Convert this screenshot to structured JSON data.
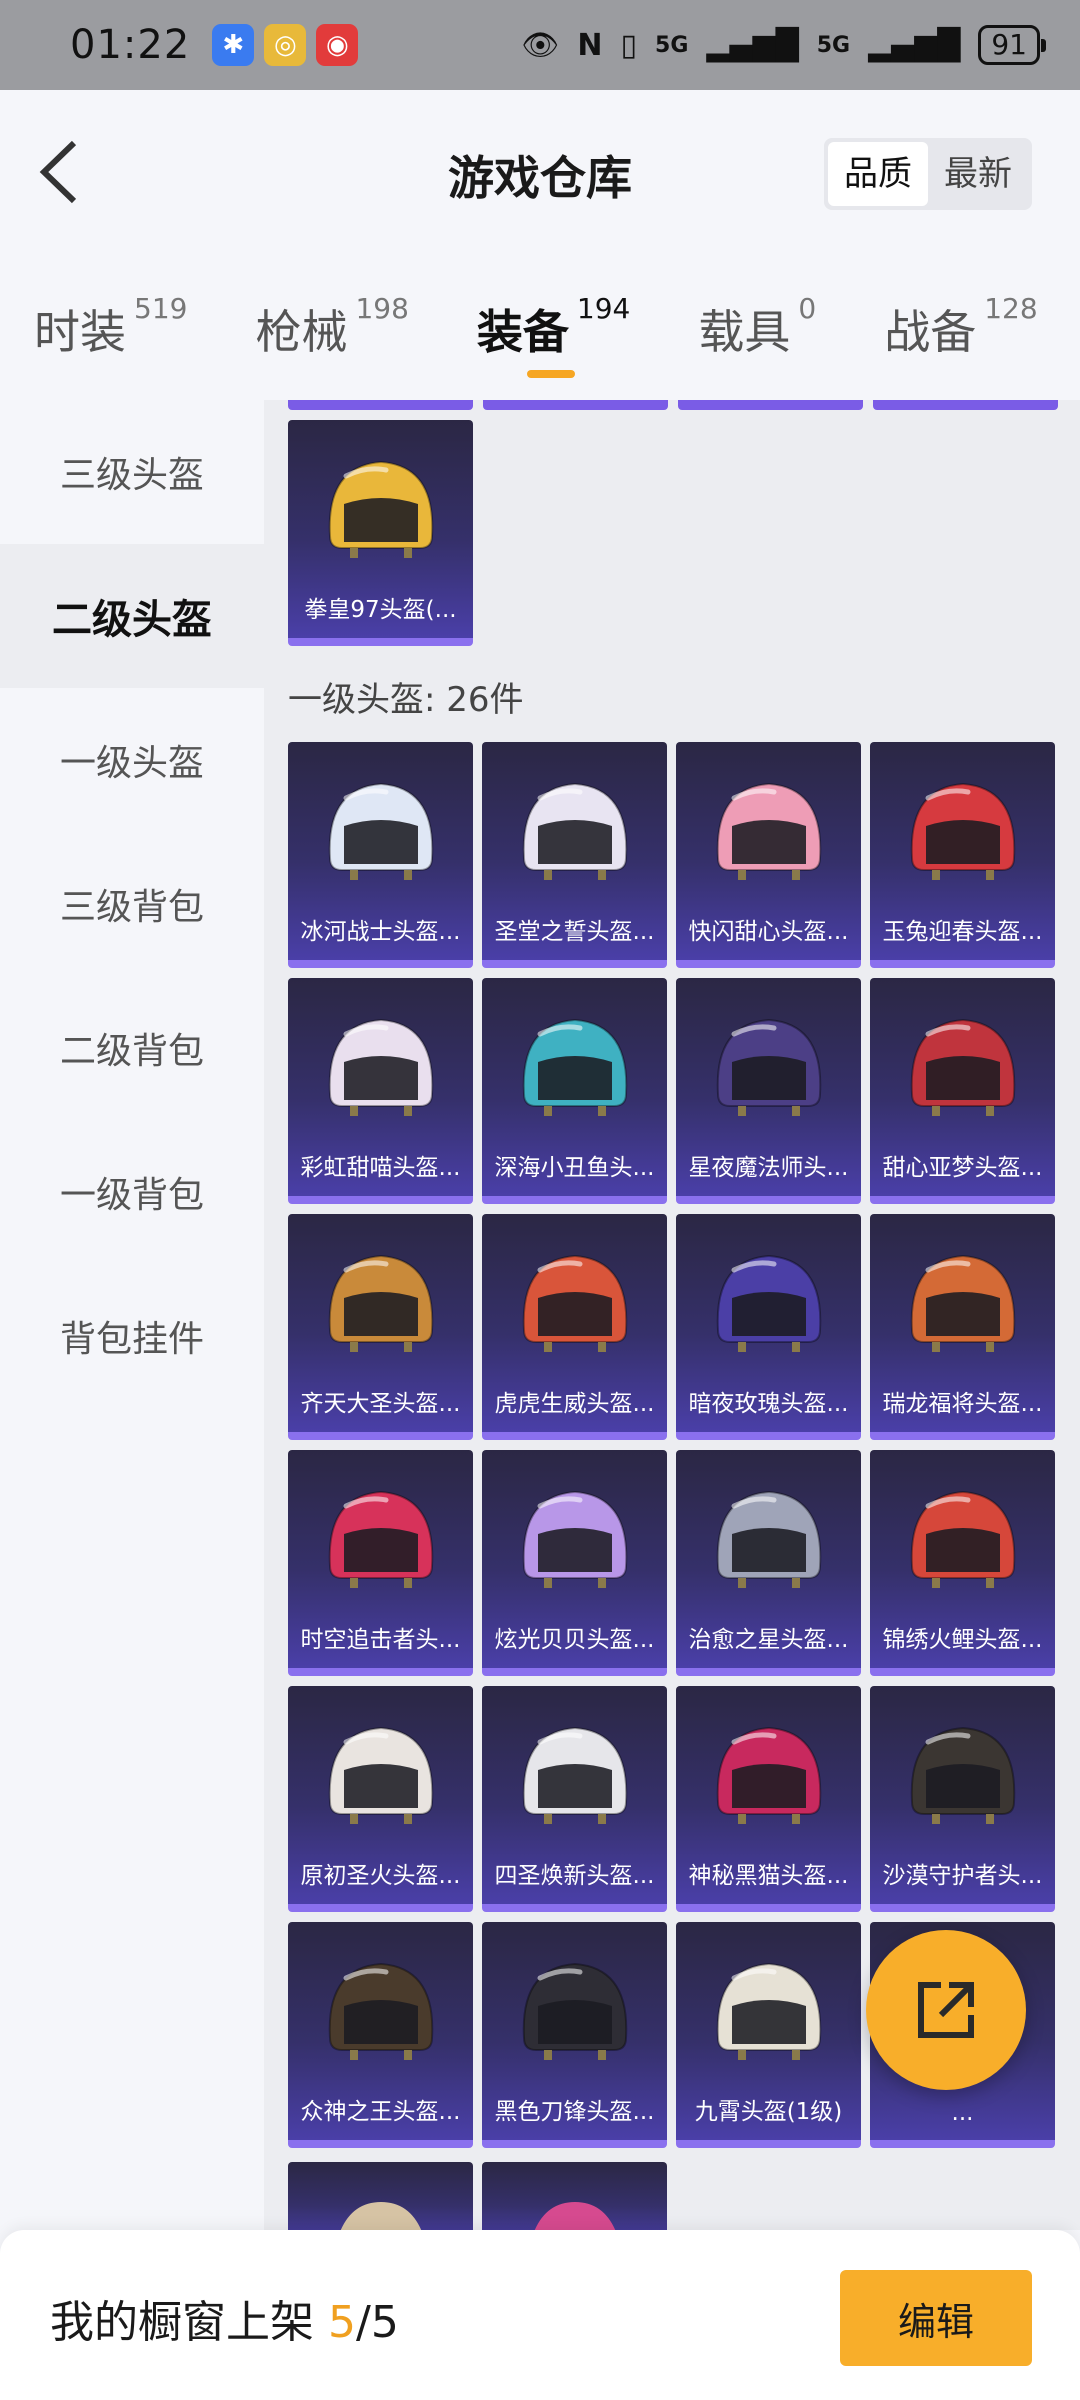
{
  "status_bar": {
    "time": "01:22",
    "network_1": "5G",
    "network_2": "5G",
    "battery": "91"
  },
  "header": {
    "title": "游戏仓库",
    "sort_quality": "品质",
    "sort_newest": "最新"
  },
  "category_tabs": [
    {
      "label": "时装",
      "count": "519"
    },
    {
      "label": "枪械",
      "count": "198"
    },
    {
      "label": "装备",
      "count": "194"
    },
    {
      "label": "载具",
      "count": "0"
    },
    {
      "label": "战备",
      "count": "128"
    }
  ],
  "sidebar": [
    {
      "label": "三级头盔"
    },
    {
      "label": "二级头盔"
    },
    {
      "label": "一级头盔"
    },
    {
      "label": "三级背包"
    },
    {
      "label": "二级背包"
    },
    {
      "label": "一级背包"
    },
    {
      "label": "背包挂件"
    }
  ],
  "level2_items": [
    {
      "name": "拳皇97头盔(...",
      "color": "#e9b73a"
    }
  ],
  "section_level1": "一级头盔: 26件",
  "level1_items": [
    {
      "name": "冰河战士头盔...",
      "color": "#dfe7f5"
    },
    {
      "name": "圣堂之誓头盔...",
      "color": "#e8e4f2"
    },
    {
      "name": "快闪甜心头盔...",
      "color": "#ee9db6"
    },
    {
      "name": "玉兔迎春头盔...",
      "color": "#d63a3f"
    },
    {
      "name": "彩虹甜喵头盔...",
      "color": "#e9dfee"
    },
    {
      "name": "深海小丑鱼头...",
      "color": "#3fb1c2"
    },
    {
      "name": "星夜魔法师头...",
      "color": "#4c3f86"
    },
    {
      "name": "甜心亚梦头盔...",
      "color": "#c0343d"
    },
    {
      "name": "齐天大圣头盔...",
      "color": "#c98a3a"
    },
    {
      "name": "虎虎生威头盔...",
      "color": "#d9553a"
    },
    {
      "name": "暗夜玫瑰头盔...",
      "color": "#4b3fa6"
    },
    {
      "name": "瑞龙福将头盔...",
      "color": "#d46a36"
    },
    {
      "name": "时空追击者头...",
      "color": "#d7325a"
    },
    {
      "name": "炫光贝贝头盔...",
      "color": "#b897e8"
    },
    {
      "name": "治愈之星头盔...",
      "color": "#9fa4b8"
    },
    {
      "name": "锦绣火鲤头盔...",
      "color": "#d6473a"
    },
    {
      "name": "原初圣火头盔...",
      "color": "#e9e4e0"
    },
    {
      "name": "四圣焕新头盔...",
      "color": "#e6e6ea"
    },
    {
      "name": "神秘黑猫头盔...",
      "color": "#c8295e"
    },
    {
      "name": "沙漠守护者头...",
      "color": "#3b3632"
    },
    {
      "name": "众神之王头盔...",
      "color": "#4a3b2c"
    },
    {
      "name": "黑色刀锋头盔...",
      "color": "#2e2d35"
    },
    {
      "name": "九霄头盔(1级)",
      "color": "#e6e1d5"
    },
    {
      "name": "...",
      "color": "#e24aa8"
    }
  ],
  "bottom_bar": {
    "label": "我的橱窗上架 ",
    "count_current": "5",
    "count_total": "/5",
    "edit_label": "编辑"
  }
}
